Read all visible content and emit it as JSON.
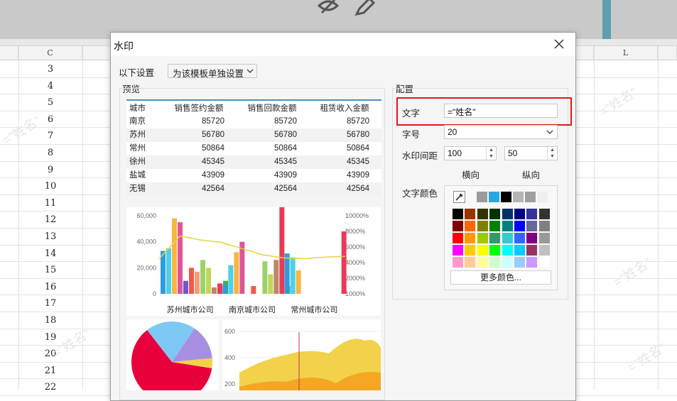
{
  "sheet": {
    "col_c": "C",
    "col_l": "L",
    "rows": [
      "3",
      "4",
      "5",
      "6",
      "7",
      "8",
      "9",
      "10",
      "11",
      "12",
      "13",
      "14",
      "15",
      "16",
      "17",
      "18",
      "19",
      "20",
      "21",
      "22"
    ],
    "watermark": "=\"姓名\"",
    "accent_teal": "#5ba0b0"
  },
  "toolbar": {
    "icons": [
      "eye-slash-icon",
      "pencil-icon"
    ]
  },
  "dialog": {
    "title": "水印",
    "scope_label": "以下设置",
    "scope_value": "为该模板单独设置",
    "preview_label": "预览",
    "config_label": "配置"
  },
  "preview_table": {
    "headers": [
      "城市",
      "销售签约金额",
      "销售回款金额",
      "租赁收入金额"
    ],
    "rows": [
      [
        "南京",
        "85720",
        "85720",
        "85720"
      ],
      [
        "苏州",
        "56780",
        "56780",
        "56780"
      ],
      [
        "常州",
        "50864",
        "50864",
        "50864"
      ],
      [
        "徐州",
        "45345",
        "45345",
        "45345"
      ],
      [
        "盐城",
        "43909",
        "43909",
        "43909"
      ],
      [
        "无锡",
        "42564",
        "42564",
        "42564"
      ]
    ],
    "header_line_color": "#4a90c8"
  },
  "config": {
    "text_label": "文字",
    "text_value": "=\"姓名\"",
    "size_label": "字号",
    "size_value": "20",
    "spacing_label": "水印间距",
    "spacing_h": "100",
    "spacing_v": "50",
    "horizontal_label": "横向",
    "vertical_label": "纵向",
    "color_label": "文字颜色",
    "more_colors": "更多颜色...",
    "highlight_color": "#e01818"
  },
  "palette": {
    "top_row": [
      "#9b9b9b",
      "#2aa7e3",
      "#000000",
      "#b5b5b5",
      "#9e9e9e",
      "#efefef"
    ],
    "grid": [
      [
        "#000000",
        "#993300",
        "#333300",
        "#003300",
        "#003366",
        "#000080",
        "#333399",
        "#333333"
      ],
      [
        "#800000",
        "#ff6600",
        "#808000",
        "#008000",
        "#008080",
        "#0000ff",
        "#666699",
        "#808080"
      ],
      [
        "#ff0000",
        "#ff9900",
        "#99cc00",
        "#339966",
        "#33cccc",
        "#3366ff",
        "#800080",
        "#999999"
      ],
      [
        "#ff00ff",
        "#ffcc00",
        "#ffff00",
        "#00ff00",
        "#00ffff",
        "#00ccff",
        "#993366",
        "#c0c0c0"
      ],
      [
        "#ff99cc",
        "#ffcc99",
        "#ffff99",
        "#ccffcc",
        "#ccffff",
        "#99ccff",
        "#cc99ff",
        "#ffffff"
      ]
    ]
  },
  "chart_data": [
    {
      "type": "bar",
      "categories": [
        "苏州城市公司",
        "南京城市公司",
        "常州城市公司"
      ],
      "y_ticks": [
        "60,000",
        "40,000",
        "20,000",
        "0"
      ],
      "y2_ticks": [
        "10000%",
        "8000%",
        "6000%",
        "4000%",
        "2000%",
        "1000%"
      ],
      "ylim": [
        0,
        60000
      ],
      "series_colors": [
        "#2f9be0",
        "#4dd0e8",
        "#f7b640",
        "#e0559a",
        "#6a5acd",
        "#f05a4a",
        "#f39c7a",
        "#9bd36a",
        "#c4d65a",
        "#b98a66",
        "#e83a5a",
        "#3cb04a"
      ],
      "groups": [
        [
          33000,
          35000,
          58000,
          55000,
          10000,
          20000,
          17000,
          26000,
          20000,
          5000,
          8000,
          10000
        ],
        [
          7000,
          22000,
          32000,
          40000,
          0,
          6000,
          0,
          25000,
          15000,
          26000,
          70000,
          6000
        ],
        [
          31000,
          28000,
          18000,
          0,
          0,
          0,
          0,
          0,
          0,
          0,
          48000,
          0
        ]
      ],
      "line": [
        45,
        74,
        69,
        66,
        58,
        50,
        46,
        45,
        47,
        48
      ]
    },
    {
      "type": "pie",
      "slices": [
        {
          "color": "#e8003c",
          "value": 62
        },
        {
          "color": "#7ec8f5",
          "value": 20
        },
        {
          "color": "#a88ee0",
          "value": 14
        },
        {
          "color": "#f2d24a",
          "value": 4
        }
      ]
    },
    {
      "type": "area",
      "y_ticks": [
        "600",
        "400",
        "200"
      ],
      "colors": [
        "#f5a623",
        "#f2d24a"
      ]
    }
  ]
}
